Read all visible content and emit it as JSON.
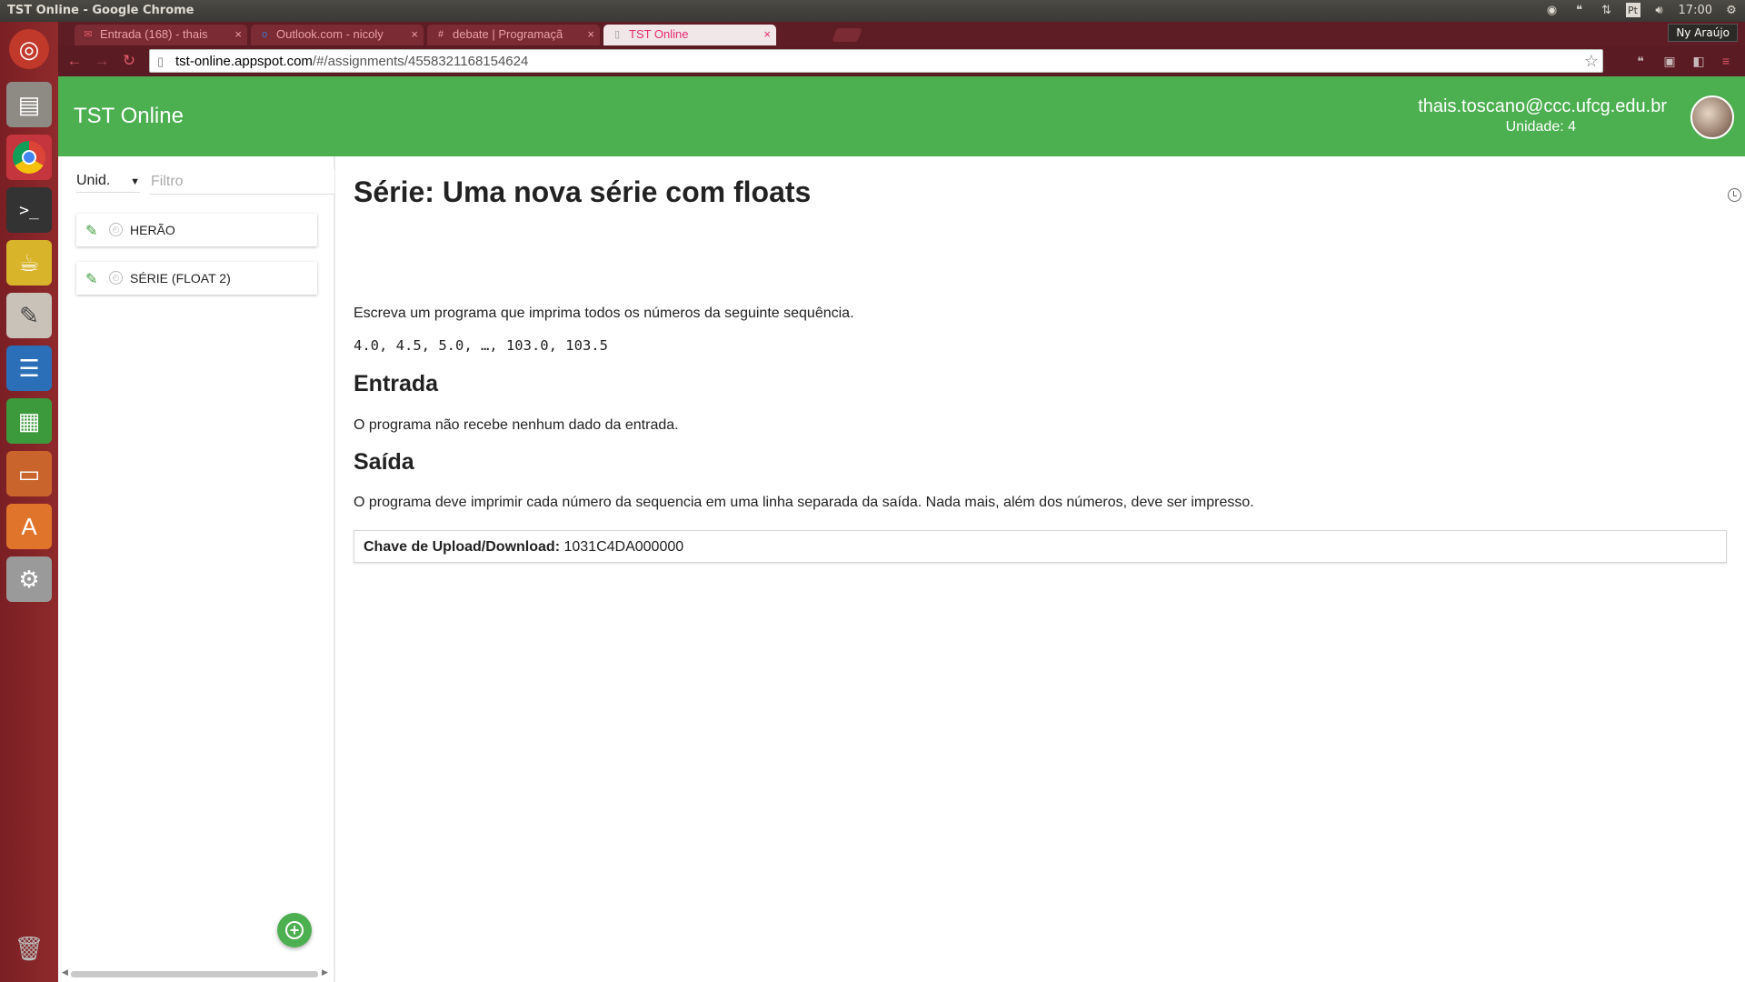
{
  "window": {
    "title": "TST Online - Google Chrome"
  },
  "panel": {
    "clock": "17:00",
    "user": "Ny Araújo",
    "lang": "Pt"
  },
  "tabs": [
    {
      "label": "Entrada (168) - thais",
      "icon": "gmail-icon"
    },
    {
      "label": "Outlook.com - nicoly",
      "icon": "outlook-icon"
    },
    {
      "label": "debate | Programaçã",
      "icon": "hash-icon"
    },
    {
      "label": "TST Online",
      "icon": "page-icon"
    }
  ],
  "address_bar": {
    "host": "tst-online.appspot.com",
    "path": "/#/assignments/4558321168154624"
  },
  "app": {
    "title": "TST Online",
    "user_email": "thais.toscano@ccc.ufcg.edu.br",
    "unit": "Unidade: 4"
  },
  "sidebar": {
    "unit_select": "Unid.",
    "filter_placeholder": "Filtro",
    "assignments": [
      {
        "label": "HERÃO"
      },
      {
        "label": "SÉRIE (FLOAT 2)"
      }
    ]
  },
  "assignment": {
    "title": "Série: Uma nova série com floats",
    "description": "Escreva um programa que imprima todos os números da seguinte sequência.",
    "sequence": "4.0, 4.5, 5.0, …, 103.0, 103.5",
    "input_heading": "Entrada",
    "input_text": "O programa não recebe nenhum dado da entrada.",
    "output_heading": "Saída",
    "output_text": "O programa deve imprimir cada número da sequencia em uma linha separada da saída. Nada mais, além dos números, deve ser impresso.",
    "key_label": "Chave de Upload/Download:",
    "key_value": "1031C4DA000000"
  },
  "colors": {
    "app_green": "#4caf50",
    "launcher": "#8f2a2c",
    "chrome_frame": "#5a1b22"
  }
}
